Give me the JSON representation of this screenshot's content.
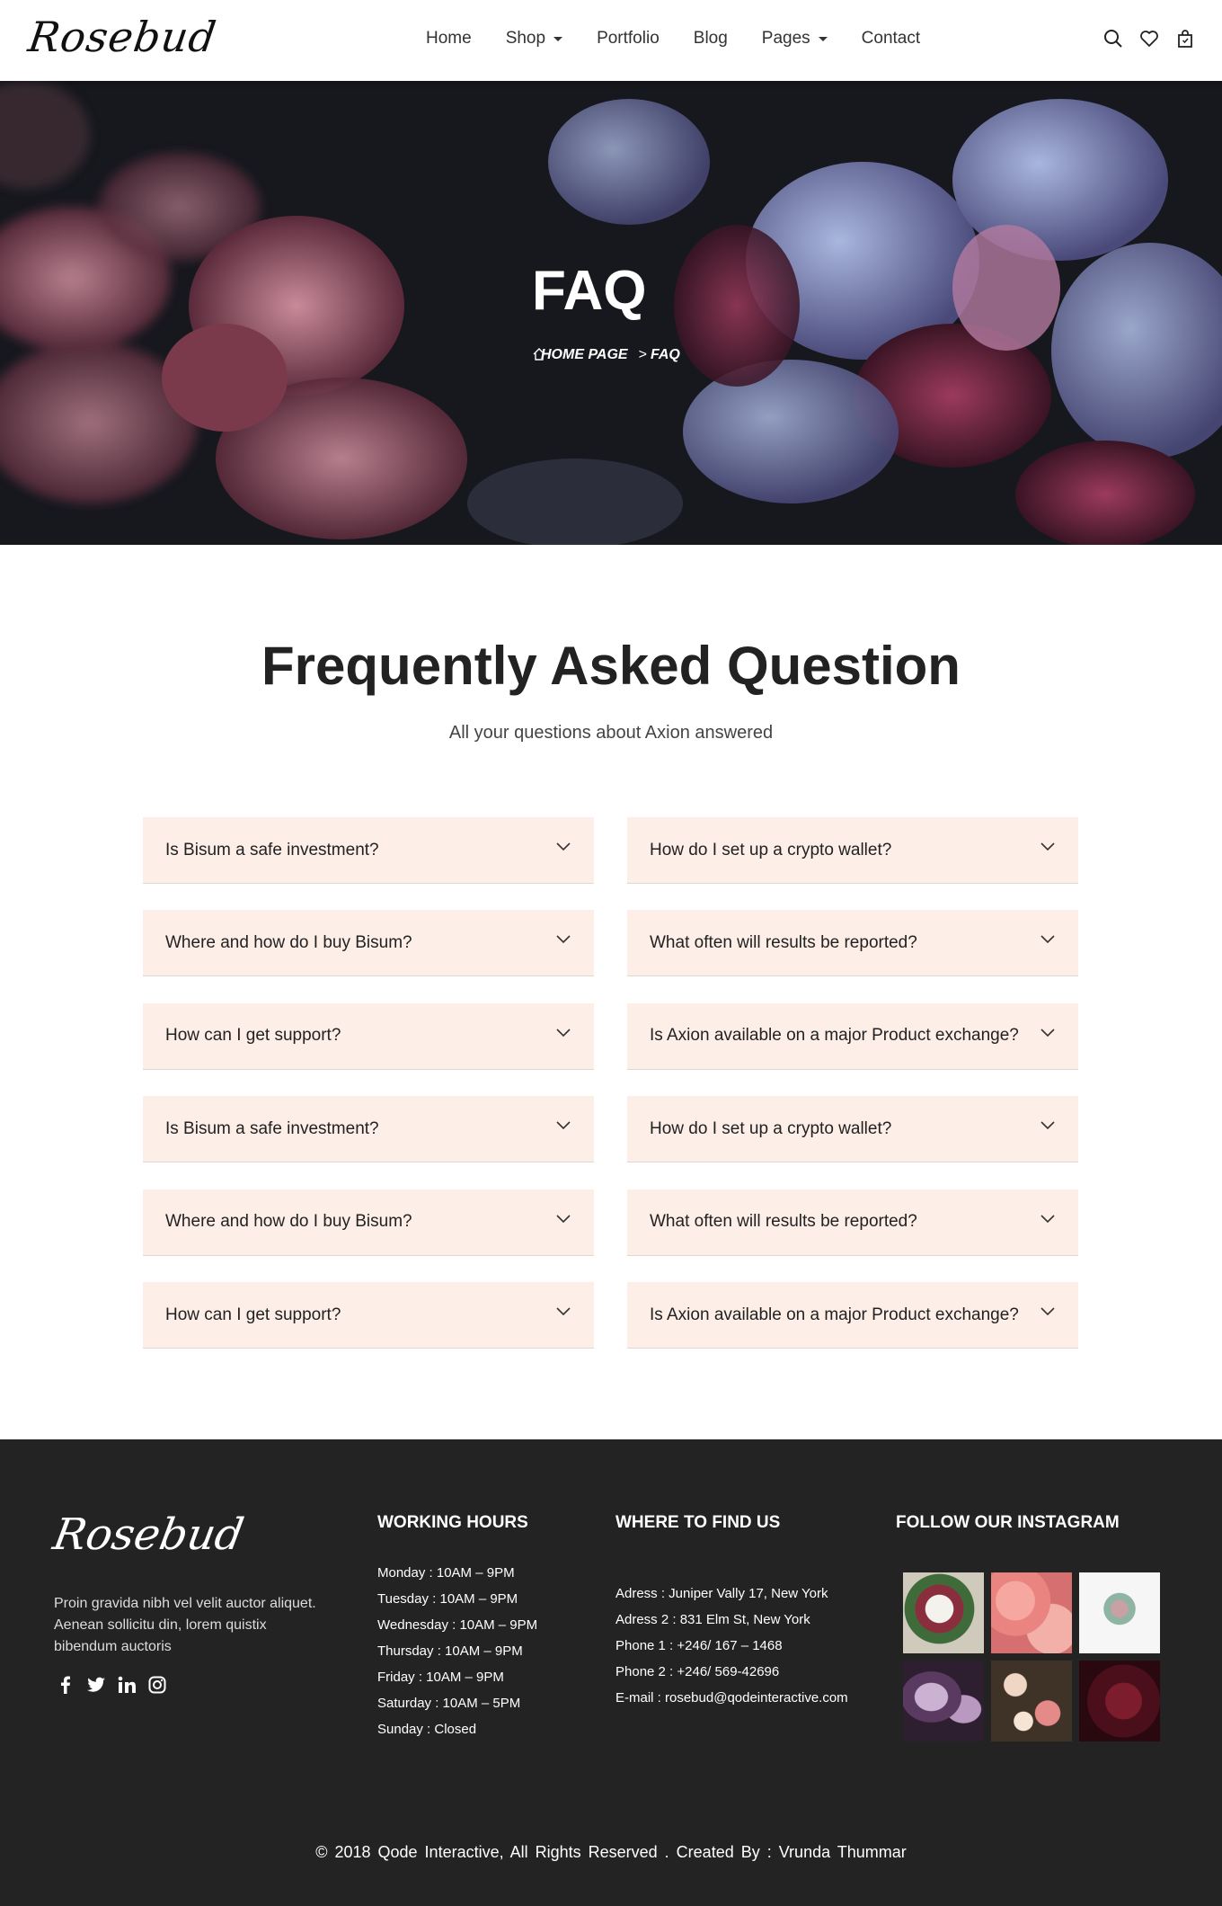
{
  "brand": "Rosebud",
  "nav": {
    "items": [
      {
        "label": "Home",
        "dropdown": false
      },
      {
        "label": "Shop",
        "dropdown": true
      },
      {
        "label": "Portfolio",
        "dropdown": false
      },
      {
        "label": "Blog",
        "dropdown": false
      },
      {
        "label": "Pages",
        "dropdown": true
      },
      {
        "label": "Contact",
        "dropdown": false
      }
    ],
    "icons": [
      "search-icon",
      "heart-icon",
      "bag-icon"
    ]
  },
  "hero": {
    "title": "FAQ",
    "breadcrumb": {
      "home": "HOME PAGE",
      "sep": ">",
      "current": "FAQ"
    }
  },
  "faq": {
    "title": "Frequently Asked Question",
    "subtitle": "All your questions about Axion answered",
    "left": [
      "Is Bisum a safe investment?",
      "Where and how do I buy Bisum?",
      "How can I get support?",
      "Is Bisum a safe investment?",
      "Where and how do I buy Bisum?",
      "How can I get support?"
    ],
    "right": [
      "How do I set up a crypto wallet?",
      "What often will results be reported?",
      "Is Axion available on a major Product exchange?",
      "How do I set up a crypto wallet?",
      "What often will results be reported?",
      "Is Axion available on a major Product exchange?"
    ]
  },
  "footer": {
    "brand": "Rosebud",
    "about": "Proin gravida nibh vel velit auctor aliquet. Aenean sollicitu din, lorem quistix bibendum auctoris",
    "social": [
      "facebook-icon",
      "twitter-icon",
      "linkedin-icon",
      "instagram-icon"
    ],
    "hours_title": "WORKING HOURS",
    "hours": [
      "Monday : 10AM – 9PM",
      "Tuesday : 10AM – 9PM",
      "Wednesday : 10AM – 9PM",
      "Thursday : 10AM – 9PM",
      "Friday : 10AM – 9PM",
      "Saturday : 10AM – 5PM",
      "Sunday : Closed"
    ],
    "where_title": "WHERE TO FIND US",
    "address": [
      "Adress : Juniper Vally 17, New York",
      "Adress 2 : 831 Elm St, New York",
      "Phone 1 : +246/ 167 – 1468",
      "Phone 2 : +246/ 569-42696",
      "E-mail : rosebud@qodeinteractive.com"
    ],
    "insta_title": "FOLLOW OUR INSTAGRAM",
    "copyright": "© 2018 Qode Interactive, All Rights Reserved . Created By : Vrunda Thummar"
  },
  "colors": {
    "faq_bg": "#fdeee7",
    "footer_bg": "#232323",
    "hero_dark": "#15171d"
  }
}
